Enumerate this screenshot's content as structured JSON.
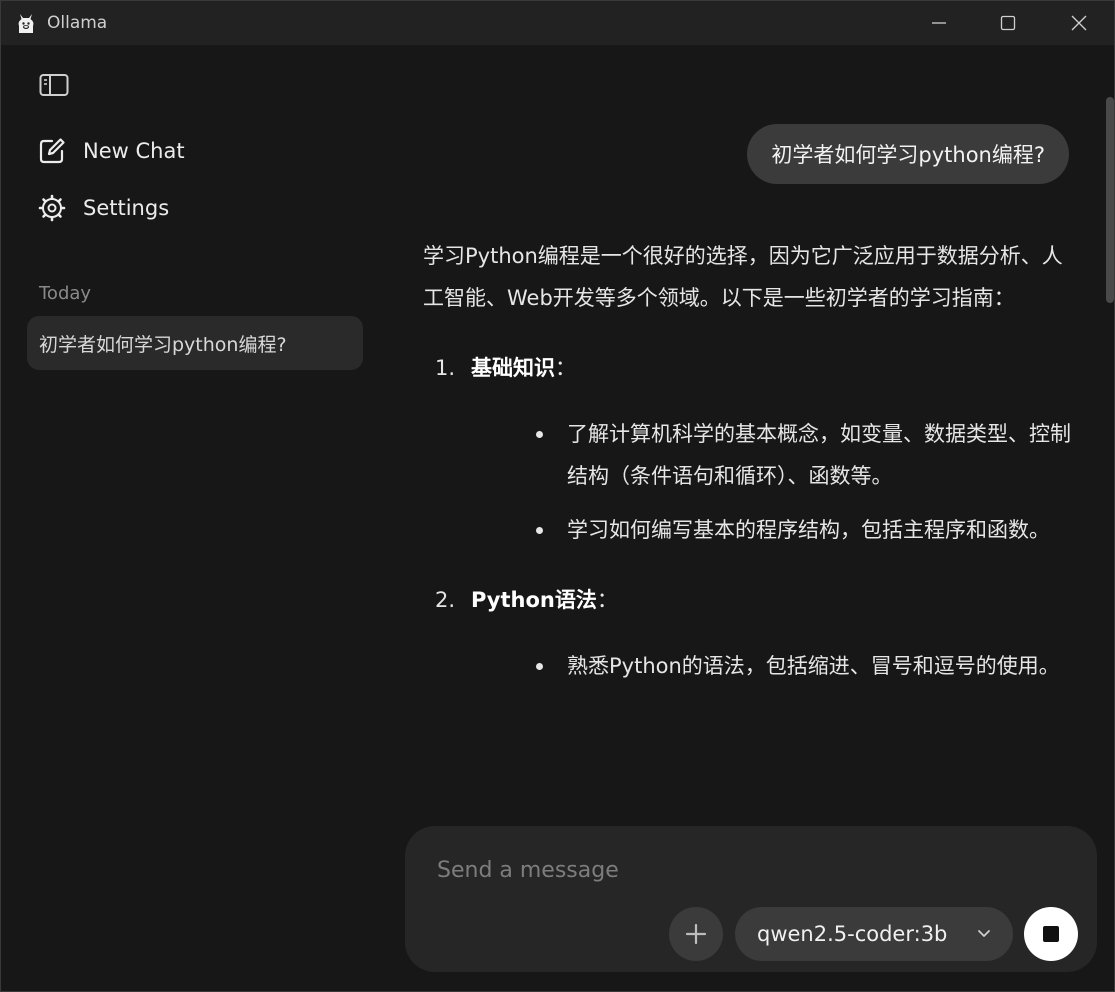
{
  "window": {
    "title": "Ollama"
  },
  "sidebar": {
    "new_chat_label": "New Chat",
    "settings_label": "Settings",
    "section_today": "Today",
    "chats": [
      "初学者如何学习python编程?"
    ]
  },
  "conversation": {
    "user_message": "初学者如何学习python编程?",
    "assistant": {
      "intro": "学习Python编程是一个很好的选择，因为它广泛应用于数据分析、人工智能、Web开发等多个领域。以下是一些初学者的学习指南：",
      "sections": [
        {
          "number": "1.",
          "title": "基础知识",
          "suffix": "：",
          "bullets": [
            "了解计算机科学的基本概念，如变量、数据类型、控制结构（条件语句和循环）、函数等。",
            "学习如何编写基本的程序结构，包括主程序和函数。"
          ]
        },
        {
          "number": "2.",
          "title": "Python语法",
          "suffix": "：",
          "bullets": [
            "熟悉Python的语法，包括缩进、冒号和逗号的使用。"
          ]
        }
      ]
    }
  },
  "composer": {
    "placeholder": "Send a message",
    "model": "qwen2.5-coder:3b"
  },
  "icons": {
    "app": "llama-icon",
    "sidebar_toggle": "sidebar-toggle-icon",
    "new_chat": "edit-icon",
    "settings": "gear-icon",
    "attach": "plus-icon",
    "model_dropdown": "chevron-down-icon",
    "stop": "stop-icon"
  },
  "colors": {
    "background": "#171717",
    "titlebar": "#222222",
    "bubble": "#3b3b3b",
    "composer": "#262626"
  }
}
